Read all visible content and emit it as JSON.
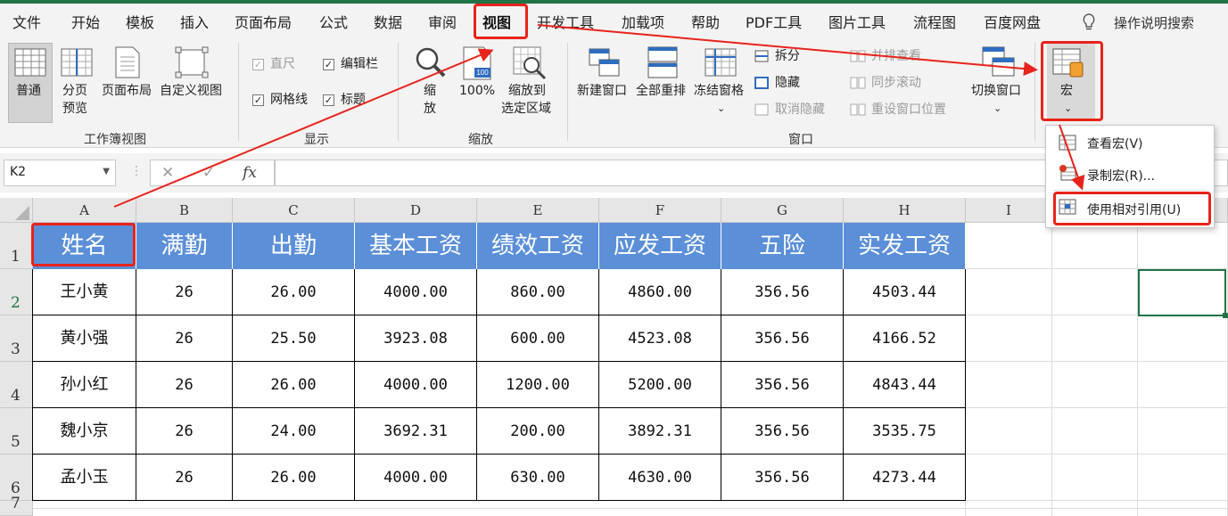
{
  "menu": {
    "items": [
      {
        "label": "文件"
      },
      {
        "label": "开始"
      },
      {
        "label": "模板"
      },
      {
        "label": "插入"
      },
      {
        "label": "页面布局"
      },
      {
        "label": "公式"
      },
      {
        "label": "数据"
      },
      {
        "label": "审阅"
      },
      {
        "label": "视图"
      },
      {
        "label": "开发工具"
      },
      {
        "label": "加载项"
      },
      {
        "label": "帮助"
      },
      {
        "label": "PDF工具"
      },
      {
        "label": "图片工具"
      },
      {
        "label": "流程图"
      },
      {
        "label": "百度网盘"
      }
    ],
    "active": "视图",
    "search_label": "操作说明搜索",
    "accent_color": "#217346"
  },
  "ribbon": {
    "workbook_views": {
      "group_label": "工作簿视图",
      "normal": "普通",
      "page_break_1": "分页",
      "page_break_2": "预览",
      "page_layout": "页面布局",
      "custom_view": "自定义视图"
    },
    "show": {
      "group_label": "显示",
      "ruler": "直尺",
      "formula_bar": "编辑栏",
      "gridlines": "网格线",
      "headings": "标题"
    },
    "zoom": {
      "group_label": "缩放",
      "zoom_1": "缩",
      "zoom_2": "放",
      "hundred": "100%",
      "icon_100": "100",
      "zoom_sel_1": "缩放到",
      "zoom_sel_2": "选定区域"
    },
    "window": {
      "group_label": "窗口",
      "new_window": "新建窗口",
      "arrange_all": "全部重排",
      "freeze_panes": "冻结窗格",
      "split": "拆分",
      "hide": "隐藏",
      "unhide": "取消隐藏",
      "side_by_side": "并排查看",
      "sync_scroll": "同步滚动",
      "reset_position": "重设窗口位置",
      "switch_windows": "切换窗口"
    },
    "macros": {
      "label": "宏"
    }
  },
  "formula_bar": {
    "name_box": "K2",
    "fx": "fx",
    "cancel": "✕",
    "enter": "✓",
    "value": ""
  },
  "macro_menu": {
    "items": [
      {
        "label": "查看宏(V)"
      },
      {
        "label": "录制宏(R)..."
      },
      {
        "label": "使用相对引用(U)"
      }
    ]
  },
  "sheet": {
    "columns": [
      "A",
      "B",
      "C",
      "D",
      "E",
      "F",
      "G",
      "H",
      "I"
    ],
    "row_numbers": [
      "1",
      "2",
      "3",
      "4",
      "5",
      "6",
      "7"
    ],
    "headers": [
      "姓名",
      "满勤",
      "出勤",
      "基本工资",
      "绩效工资",
      "应发工资",
      "五险",
      "实发工资"
    ],
    "rows": [
      [
        "王小黄",
        "26",
        "26.00",
        "4000.00",
        "860.00",
        "4860.00",
        "356.56",
        "4503.44"
      ],
      [
        "黄小强",
        "26",
        "25.50",
        "3923.08",
        "600.00",
        "4523.08",
        "356.56",
        "4166.52"
      ],
      [
        "孙小红",
        "26",
        "26.00",
        "4000.00",
        "1200.00",
        "5200.00",
        "356.56",
        "4843.44"
      ],
      [
        "魏小京",
        "26",
        "24.00",
        "3692.31",
        "200.00",
        "3892.31",
        "356.56",
        "3535.75"
      ],
      [
        "孟小玉",
        "26",
        "26.00",
        "4000.00",
        "630.00",
        "4630.00",
        "356.56",
        "4273.44"
      ]
    ],
    "header_fill": "#5b8fd8",
    "selected_cell": "K2"
  },
  "annotation_color": "#e8231b"
}
